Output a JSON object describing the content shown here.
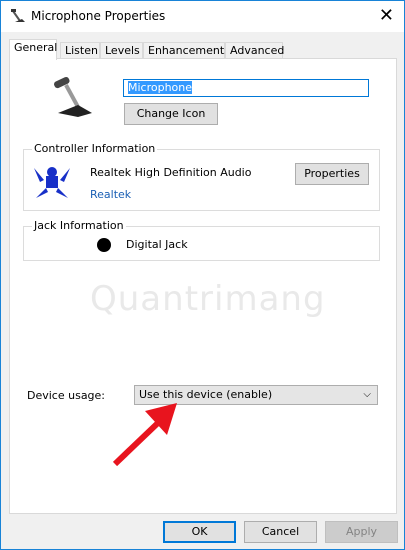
{
  "window": {
    "title": "Microphone Properties",
    "icon": "microphone-icon"
  },
  "tabs": [
    {
      "label": "General",
      "active": true
    },
    {
      "label": "Listen"
    },
    {
      "label": "Levels"
    },
    {
      "label": "Enhancements"
    },
    {
      "label": "Advanced"
    }
  ],
  "general": {
    "device_name": "Microphone",
    "change_icon_label": "Change Icon",
    "controller": {
      "heading": "Controller Information",
      "name": "Realtek High Definition Audio",
      "vendor_link": "Realtek",
      "properties_label": "Properties"
    },
    "jack": {
      "heading": "Jack Information",
      "name": "Digital Jack"
    },
    "device_usage_label": "Device usage:",
    "device_usage_value": "Use this device (enable)"
  },
  "watermark": "Quantrimang",
  "buttons": {
    "ok": "OK",
    "cancel": "Cancel",
    "apply": "Apply"
  },
  "colors": {
    "accent": "#0078d7",
    "link": "#1a5fb4",
    "arrow": "#e8141e"
  }
}
